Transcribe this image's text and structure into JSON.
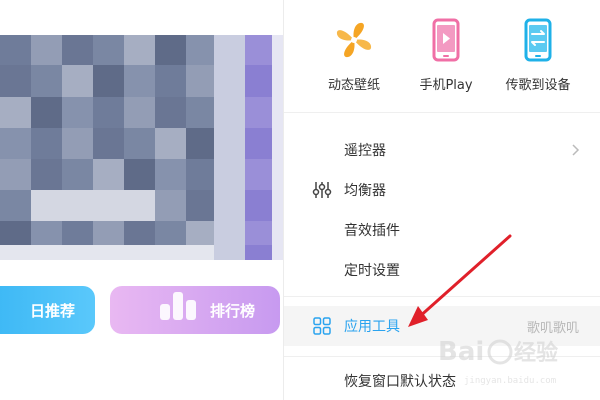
{
  "quick_actions": [
    {
      "label": "动态壁纸",
      "icon": "pinwheel-icon",
      "color": "#f5a524"
    },
    {
      "label": "手机Play",
      "icon": "phone-play-icon",
      "color": "#f06fa6"
    },
    {
      "label": "传歌到设备",
      "icon": "phone-transfer-icon",
      "color": "#1fb1e8"
    }
  ],
  "menu": {
    "remote": {
      "label": "遥控器"
    },
    "equalizer": {
      "label": "均衡器",
      "icon": "equalizer-icon"
    },
    "sound_plugin": {
      "label": "音效插件"
    },
    "timer": {
      "label": "定时设置"
    },
    "app_tools": {
      "label": "应用工具",
      "icon": "grid-icon",
      "sub": "歌叽歌叽"
    },
    "restore_window": {
      "label": "恢复窗口默认状态"
    }
  },
  "background_buttons": {
    "daily": "日推荐",
    "rank": "排行榜"
  },
  "annotation": {
    "arrow_color": "#e0202a"
  },
  "watermark": {
    "text": "Baidu经验",
    "url": "jingyan.baidu.com"
  },
  "colors": {
    "accent": "#2aa3ef",
    "highlight_bg": "#f5f5f5"
  }
}
